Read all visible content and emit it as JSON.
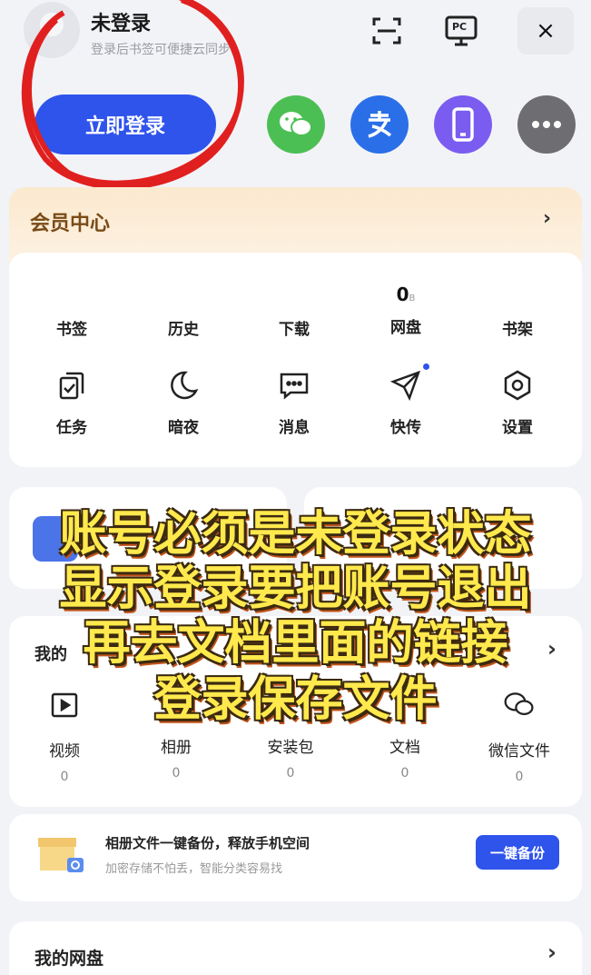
{
  "header": {
    "title": "未登录",
    "subtitle": "登录后书签可便捷云同步",
    "pc_label": "PC",
    "close": "×"
  },
  "login_button": "立即登录",
  "member": {
    "title": "会员中心",
    "chevron": "›"
  },
  "tools_row1": [
    {
      "label": "书签"
    },
    {
      "label": "历史"
    },
    {
      "label": "下载"
    },
    {
      "label": "网盘",
      "count": "0",
      "unit": "B"
    },
    {
      "label": "书架"
    }
  ],
  "tools_row2": [
    {
      "label": "任务",
      "icon": "task-icon"
    },
    {
      "label": "暗夜",
      "icon": "moon-icon"
    },
    {
      "label": "消息",
      "icon": "message-icon"
    },
    {
      "label": "快传",
      "icon": "send-icon"
    },
    {
      "label": "设置",
      "icon": "gear-icon"
    }
  ],
  "files": {
    "title": "我的",
    "chevron": "›",
    "items": [
      {
        "label": "视频",
        "count": "0"
      },
      {
        "label": "相册",
        "count": "0"
      },
      {
        "label": "安装包",
        "count": "0"
      },
      {
        "label": "文档",
        "count": "0"
      },
      {
        "label": "微信文件",
        "count": "0"
      }
    ]
  },
  "backup": {
    "title": "相册文件一键备份，释放手机空间",
    "subtitle": "加密存储不怕丢，智能分类容易找",
    "button": "一键备份"
  },
  "pan": {
    "title": "我的网盘",
    "chevron": "›"
  },
  "overlay_lines": [
    "账号必须是未登录状态",
    "显示登录要把账号退出",
    "再去文档里面的链接",
    "登录保存文件"
  ],
  "colors": {
    "primary": "#2f54eb",
    "wechat": "#4cbf54",
    "alipay": "#2a6fe8",
    "phone": "#7a5cf0",
    "more": "#6e6e72",
    "annotation": "#e0201f"
  }
}
